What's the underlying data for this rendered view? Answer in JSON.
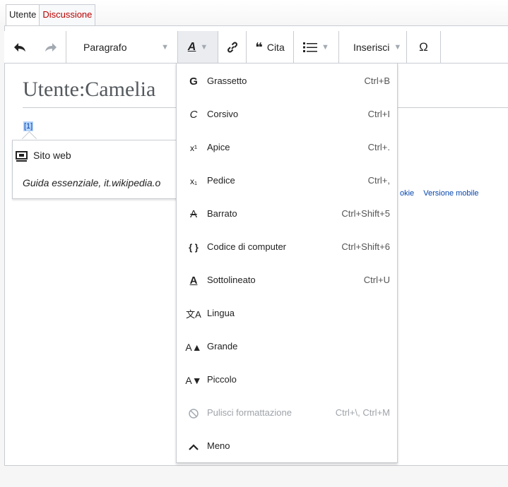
{
  "tabs": [
    {
      "label": "Utente"
    },
    {
      "label": "Discussione"
    }
  ],
  "toolbar": {
    "paragraph_label": "Paragrafo",
    "style_icon": "A",
    "cite_label": "Cita",
    "insert_label": "Inserisci",
    "special_char": "Ω"
  },
  "page": {
    "title": "Utente:Camelia",
    "ref_marker": "[1]"
  },
  "popup": {
    "title": "Sito web",
    "cite_italic": "Guida essenziale",
    "cite_rest": ", it.wikipedia.o"
  },
  "footer": {
    "cookie_fragment": "okie",
    "mobile_link": "Versione mobile"
  },
  "menu": {
    "items": [
      {
        "icon": "G",
        "label": "Grassetto",
        "shortcut": "Ctrl+B",
        "icon_name": "bold-icon"
      },
      {
        "icon": "C",
        "label": "Corsivo",
        "shortcut": "Ctrl+I",
        "icon_name": "italic-icon"
      },
      {
        "icon": "x¹",
        "label": "Apice",
        "shortcut": "Ctrl+.",
        "icon_name": "superscript-icon"
      },
      {
        "icon": "x₁",
        "label": "Pedice",
        "shortcut": "Ctrl+,",
        "icon_name": "subscript-icon"
      },
      {
        "icon": "A",
        "label": "Barrato",
        "shortcut": "Ctrl+Shift+5",
        "icon_name": "strikethrough-icon"
      },
      {
        "icon": "{ }",
        "label": "Codice di computer",
        "shortcut": "Ctrl+Shift+6",
        "icon_name": "code-icon"
      },
      {
        "icon": "A",
        "label": "Sottolineato",
        "shortcut": "Ctrl+U",
        "icon_name": "underline-icon"
      },
      {
        "icon": "文A",
        "label": "Lingua",
        "shortcut": "",
        "icon_name": "language-icon"
      },
      {
        "icon": "A▲",
        "label": "Grande",
        "shortcut": "",
        "icon_name": "bigger-icon"
      },
      {
        "icon": "A▼",
        "label": "Piccolo",
        "shortcut": "",
        "icon_name": "smaller-icon"
      },
      {
        "icon": "⃠",
        "label": "Pulisci formattazione",
        "shortcut": "Ctrl+\\, Ctrl+M",
        "icon_name": "clear-format-icon"
      },
      {
        "icon": "^",
        "label": "Meno",
        "shortcut": "",
        "icon_name": "chevron-up-icon"
      }
    ]
  }
}
